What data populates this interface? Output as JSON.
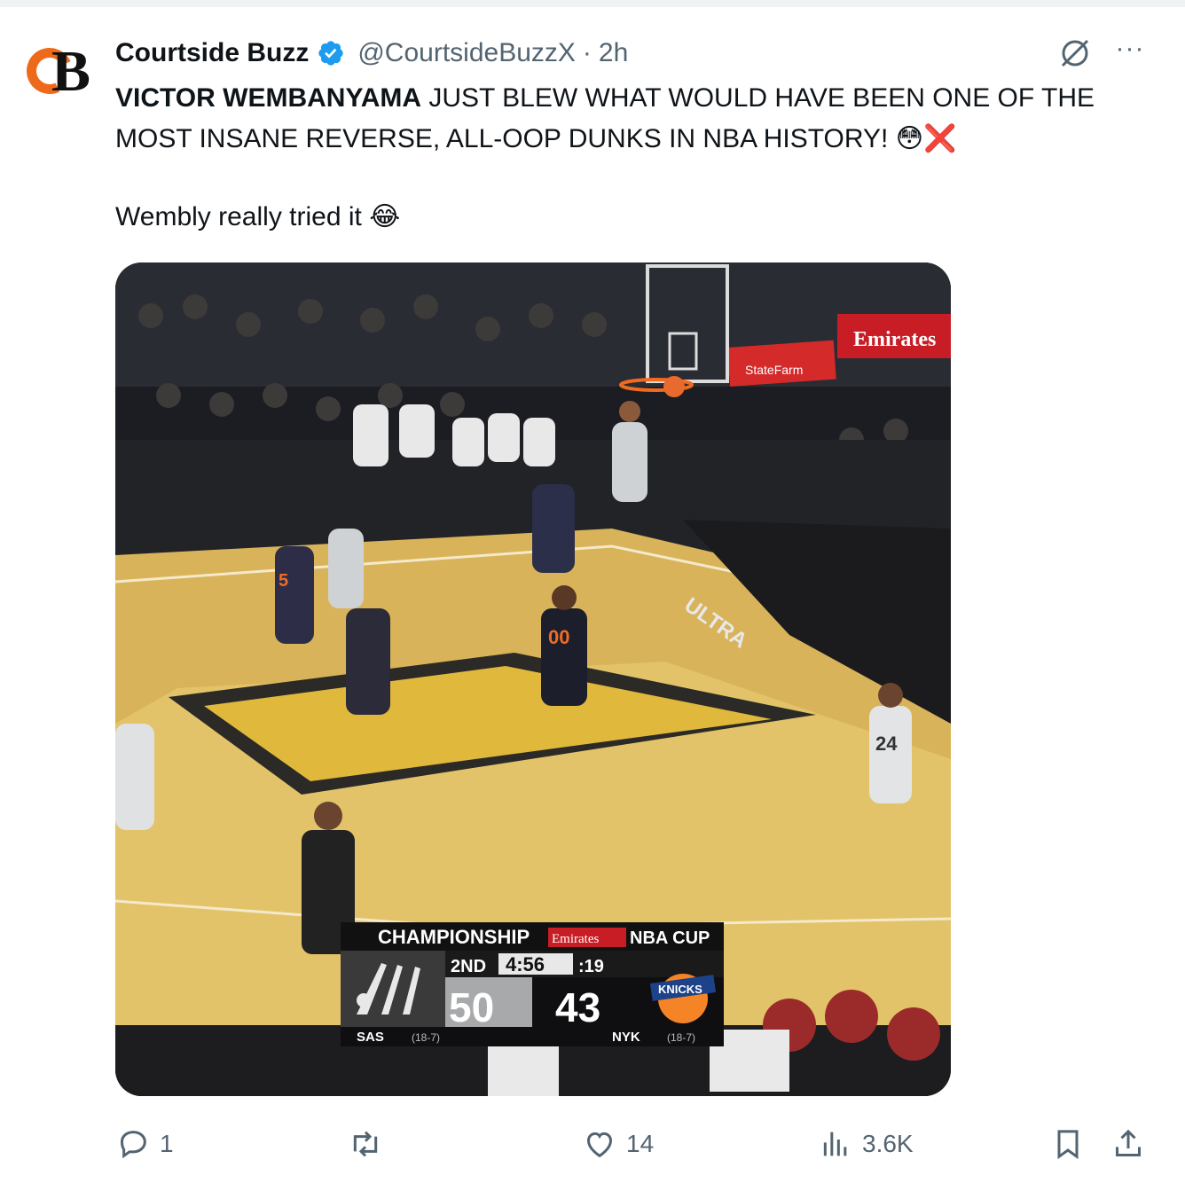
{
  "tweet": {
    "author_name": "Courtside Buzz",
    "handle": "@CourtsideBuzzX",
    "separator": "·",
    "time": "2h",
    "more_label": "···",
    "text_highlight": "VICTOR WEMBANYAMA",
    "text_rest": " JUST BLEW WHAT WOULD HAVE BEEN ONE OF THE MOST INSANE REVERSE, ALL-OOP DUNKS IN NBA HISTORY! ",
    "text_emoji": "😳❌",
    "sub_text": "Wembly really tried it ",
    "sub_emoji": "😂"
  },
  "media": {
    "scoreboard": {
      "event": "CHAMPIONSHIP",
      "sponsor": "Emirates",
      "cup": "NBA CUP",
      "quarter": "2ND",
      "clock": "4:56",
      "shot_clock": ":19",
      "home_team": "SAS",
      "home_record": "(18-7)",
      "home_score": "50",
      "away_team": "NYK",
      "away_record": "(18-7)",
      "away_score": "43"
    },
    "court_text": "ULTRA",
    "banner": "Emirates",
    "banner2": "StateFarm",
    "jersey_numbers": [
      "00",
      "24",
      "5"
    ]
  },
  "actions": {
    "replies": "1",
    "retweets": "",
    "likes": "14",
    "views": "3.6K"
  },
  "colors": {
    "verified": "#1d9bf0",
    "avatar_accent": "#ee6a1a",
    "muted": "#536471"
  }
}
